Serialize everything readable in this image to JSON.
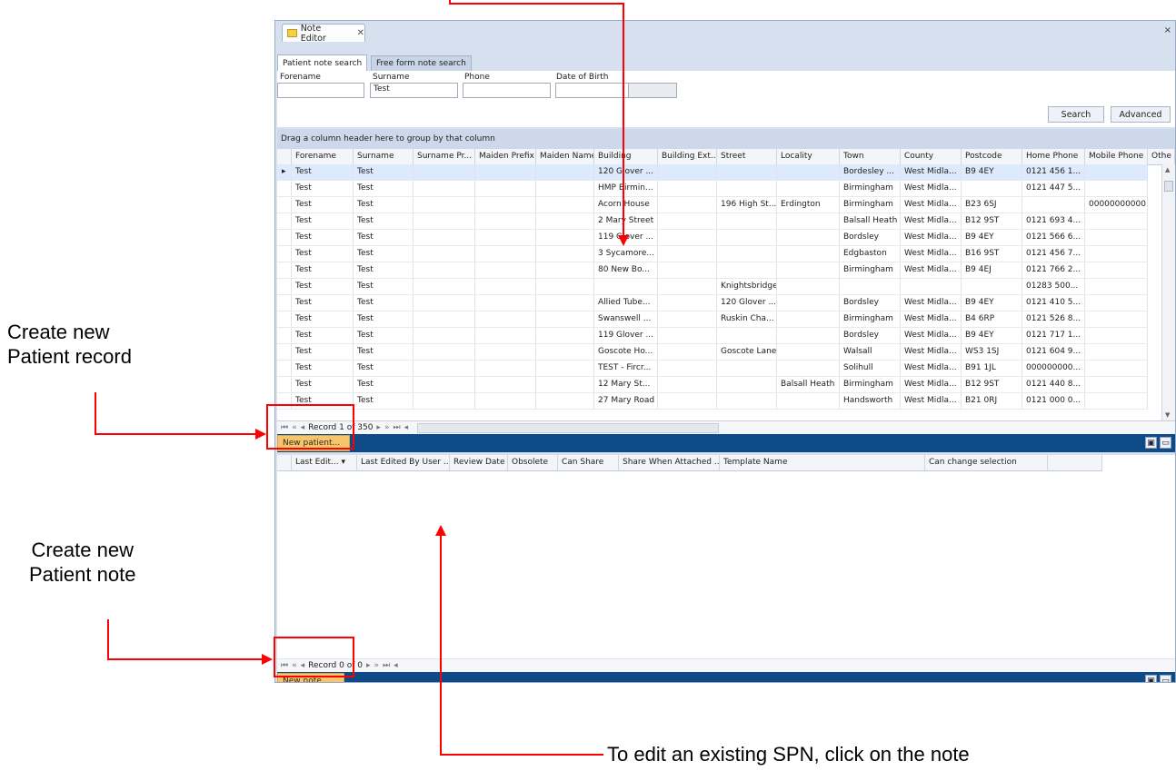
{
  "window": {
    "tab_title": "Note Editor",
    "close_glyph": "×",
    "tab_close_glyph": "✕"
  },
  "search": {
    "tabs": [
      {
        "label": "Patient note search",
        "active": true
      },
      {
        "label": "Free form note search",
        "active": false
      }
    ],
    "fields": {
      "forename": {
        "label": "Forename",
        "value": ""
      },
      "surname": {
        "label": "Surname",
        "value": "Test"
      },
      "phone": {
        "label": "Phone",
        "value": ""
      },
      "dob": {
        "label": "Date of Birth",
        "value": ""
      }
    },
    "search_button": "Search",
    "advanced_button": "Advanced"
  },
  "patient_grid": {
    "group_hint": "Drag a column header here to group by that column",
    "columns": [
      "Forename",
      "Surname",
      "Surname Pr...",
      "Maiden Prefix",
      "Maiden Name",
      "Building",
      "Building Ext...",
      "Street",
      "Locality",
      "Town",
      "County",
      "Postcode",
      "Home Phone",
      "Mobile Phone",
      "Othe"
    ],
    "rows": [
      [
        "Test",
        "Test",
        "",
        "",
        "",
        "120 Glover ...",
        "",
        "",
        "",
        "Bordesley ...",
        "West Midla...",
        "B9 4EY",
        "0121 456 1...",
        ""
      ],
      [
        "Test",
        "Test",
        "",
        "",
        "",
        "HMP Birmin...",
        "",
        "",
        "",
        "Birmingham",
        "West Midla...",
        "",
        "0121 447 5...",
        ""
      ],
      [
        "Test",
        "Test",
        "",
        "",
        "",
        "Acorn House",
        "",
        "196 High St...",
        "Erdington",
        "Birmingham",
        "West Midla...",
        "B23 6SJ",
        "",
        "00000000000"
      ],
      [
        "Test",
        "Test",
        "",
        "",
        "",
        "2 Mary Street",
        "",
        "",
        "",
        "Balsall Heath",
        "West Midla...",
        "B12 9ST",
        "0121 693 4...",
        ""
      ],
      [
        "Test",
        "Test",
        "",
        "",
        "",
        "119 Glover ...",
        "",
        "",
        "",
        "Bordsley",
        "West Midla...",
        "B9 4EY",
        "0121 566 6...",
        ""
      ],
      [
        "Test",
        "Test",
        "",
        "",
        "",
        "3 Sycamore...",
        "",
        "",
        "",
        "Edgbaston",
        "West Midla...",
        "B16 9ST",
        "0121 456 7...",
        ""
      ],
      [
        "Test",
        "Test",
        "",
        "",
        "",
        "80 New Bo...",
        "",
        "",
        "",
        "Birmingham",
        "West Midla...",
        "B9 4EJ",
        "0121 766 2...",
        ""
      ],
      [
        "Test",
        "Test",
        "",
        "",
        "",
        "",
        "",
        "Knightsbridge",
        "",
        "",
        "",
        "",
        "01283 500...",
        ""
      ],
      [
        "Test",
        "Test",
        "",
        "",
        "",
        "Allied Tube...",
        "",
        "120 Glover ...",
        "",
        "Bordsley",
        "West Midla...",
        "B9 4EY",
        "0121 410 5...",
        ""
      ],
      [
        "Test",
        "Test",
        "",
        "",
        "",
        "Swanswell ...",
        "",
        "Ruskin Cha...",
        "",
        "Birmingham",
        "West Midla...",
        "B4 6RP",
        "0121 526 8...",
        ""
      ],
      [
        "Test",
        "Test",
        "",
        "",
        "",
        "119 Glover ...",
        "",
        "",
        "",
        "Bordsley",
        "West Midla...",
        "B9 4EY",
        "0121 717 1...",
        ""
      ],
      [
        "Test",
        "Test",
        "",
        "",
        "",
        "Goscote Ho...",
        "",
        "Goscote Lane",
        "",
        "Walsall",
        "West Midla...",
        "WS3 1SJ",
        "0121 604 9...",
        ""
      ],
      [
        "Test",
        "Test",
        "",
        "",
        "",
        "TEST - Fircr...",
        "",
        "",
        "",
        "Solihull",
        "West Midla...",
        "B91 1JL",
        "000000000...",
        ""
      ],
      [
        "Test",
        "Test",
        "",
        "",
        "",
        "12 Mary St...",
        "",
        "",
        "Balsall Heath",
        "Birmingham",
        "West Midla...",
        "B12 9ST",
        "0121 440 8...",
        ""
      ],
      [
        "Test",
        "Test",
        "",
        "",
        "",
        "27 Mary Road",
        "",
        "",
        "",
        "Handsworth",
        "West Midla...",
        "B21 0RJ",
        "0121 000 0...",
        ""
      ]
    ],
    "navigator_text": "Record 1 of 350",
    "new_button": "New patient..."
  },
  "notes_grid": {
    "columns": [
      "Last Edit...",
      "Last Edited By User ...",
      "Review Date",
      "Obsolete",
      "Can Share",
      "Share When Attached ...",
      "Template Name",
      "Can change selection"
    ],
    "navigator_text": "Record 0 of 0",
    "new_button": "New note..."
  },
  "annotations": {
    "create_record": [
      "Create new",
      "Patient record"
    ],
    "create_note": [
      "Create new",
      "Patient note"
    ],
    "edit_note": "To edit an existing SPN, click on the note"
  },
  "colors": {
    "accent_bar": "#0e4a87",
    "orange_button": "#f9c56b",
    "annotation": "#ff0000"
  }
}
